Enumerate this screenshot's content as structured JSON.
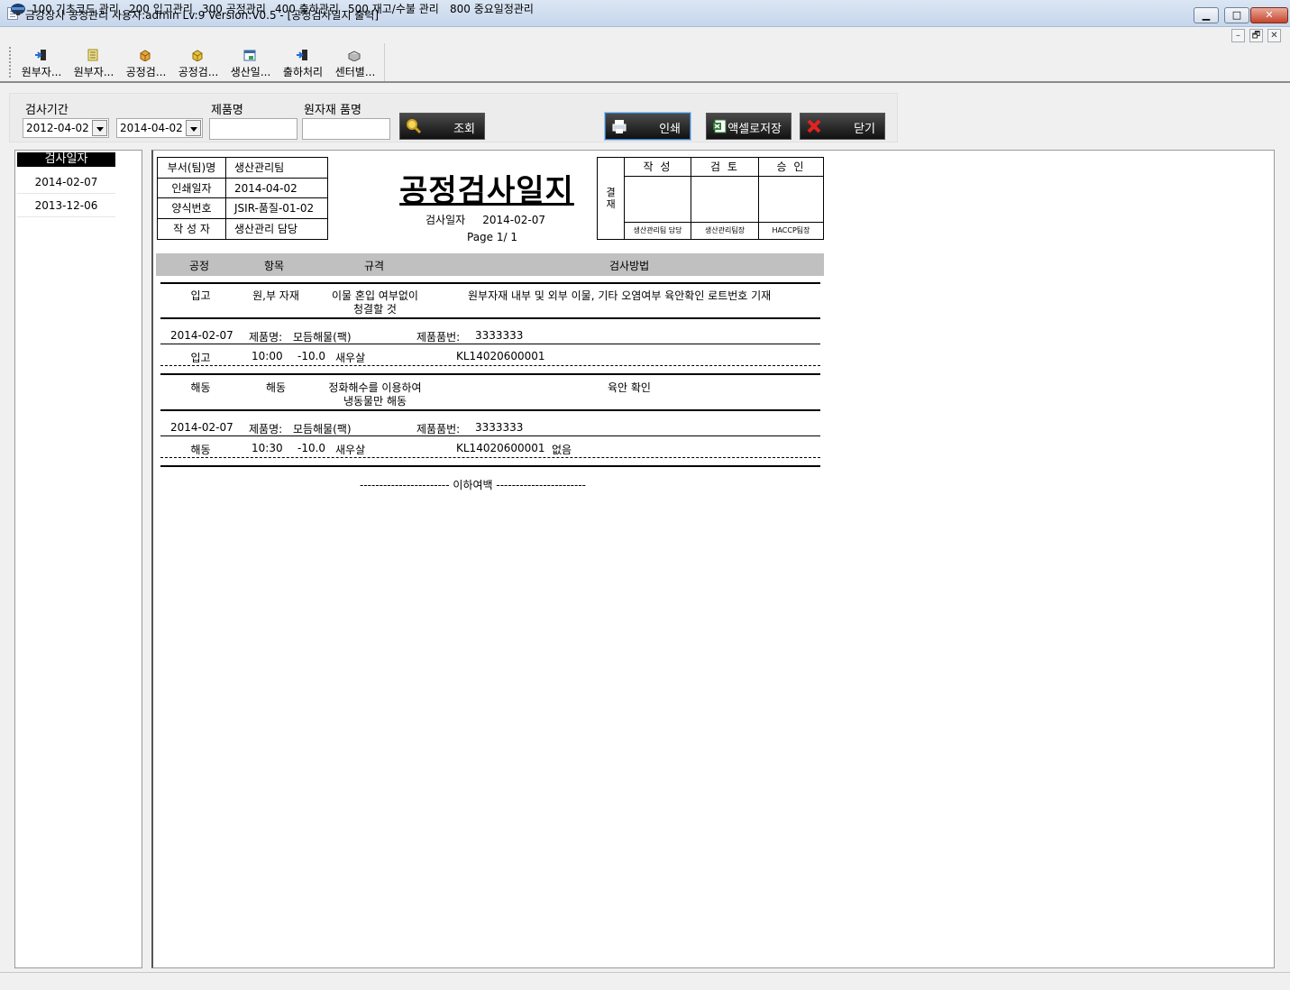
{
  "window": {
    "title": "금강상사 공정관리 사용자:admin Lv:9  Version:V0.5 - [공정검사일지 출력]",
    "minimize": "▁",
    "maximize": "□",
    "close": "✕"
  },
  "menu": {
    "items": [
      "100 기초코드 관리",
      "200 입고관리",
      "300 공정관리",
      "400 출하관리",
      "500 재고/수불 관리",
      "800 중요일정관리"
    ],
    "mdi_min": "–",
    "mdi_restore": "🗗",
    "mdi_close": "✕"
  },
  "toolbar": {
    "buttons": [
      {
        "label": "원부자...",
        "icon": "door-arrow-icon"
      },
      {
        "label": "원부자...",
        "icon": "document-icon"
      },
      {
        "label": "공정검...",
        "icon": "box-icon"
      },
      {
        "label": "공정검...",
        "icon": "box-icon"
      },
      {
        "label": "생산일...",
        "icon": "calendar-icon"
      },
      {
        "label": "출하처리",
        "icon": "door-arrow-icon"
      },
      {
        "label": "센터별...",
        "icon": "package-icon"
      }
    ]
  },
  "search": {
    "period_label": "검사기간",
    "date_from": "2012-04-02",
    "date_to": "2014-04-02",
    "product_label": "제품명",
    "product_value": "",
    "material_label": "원자재 품명",
    "material_value": "",
    "query_button": "조회",
    "print_button": "인쇄",
    "excel_button": "액셀로저장",
    "close_button": "닫기"
  },
  "date_list": {
    "header": "검사일자",
    "items": [
      "2014-02-07",
      "2013-12-06"
    ]
  },
  "report": {
    "info": [
      {
        "key": "부서(팀)명",
        "value": "생산관리팀"
      },
      {
        "key": "인쇄일자",
        "value": "2014-04-02"
      },
      {
        "key": "양식번호",
        "value": "JSIR-품질-01-02"
      },
      {
        "key": "작 성 자",
        "value": "생산관리 담당"
      }
    ],
    "title": "공정검사일지",
    "date_line": "검사일자     2014-02-07",
    "page": "Page 1/ 1",
    "approval": {
      "side_label": "결\n재",
      "columns": [
        {
          "head": "작 성",
          "foot": "생산관리팀 담당"
        },
        {
          "head": "검 토",
          "foot": "생산관리팀장"
        },
        {
          "head": "승 인",
          "foot": "HACCP팀장"
        }
      ]
    },
    "columns": [
      "공정",
      "항목",
      "규격",
      "검사방법"
    ],
    "sections": [
      {
        "process": "입고",
        "item": "원,부 자재",
        "spec_line1": "이물 혼입 여부없이",
        "spec_line2": "청결할 것",
        "method": "원부자재 내부 및 외부 이물, 기타 오염여부 육안확인 로트번호 기재",
        "date": "2014-02-07",
        "product_label": "제품명:",
        "product": "모듬해물(팩)",
        "code_label": "제품품번:",
        "code": "3333333",
        "record": {
          "process": "입고",
          "time": "10:00",
          "temp": "-10.0",
          "material": "새우살",
          "lot": "KL14020600001",
          "note": ""
        }
      },
      {
        "process": "해동",
        "item": "해동",
        "spec_line1": "정화해수를 이용하여",
        "spec_line2": "냉동물만 해동",
        "method": "육안 확인",
        "date": "2014-02-07",
        "product_label": "제품명:",
        "product": "모듬해물(팩)",
        "code_label": "제품품번:",
        "code": "3333333",
        "record": {
          "process": "해동",
          "time": "10:30",
          "temp": "-10.0",
          "material": "새우살",
          "lot": "KL14020600001",
          "note": "없음"
        }
      }
    ],
    "end_note": "----------------------- 이하여백 -----------------------"
  },
  "colors": {
    "titlebar": "#c6d6eb",
    "button_dark": "#111111",
    "header_gray": "#c0c0c0",
    "close_red": "#c6442b"
  }
}
